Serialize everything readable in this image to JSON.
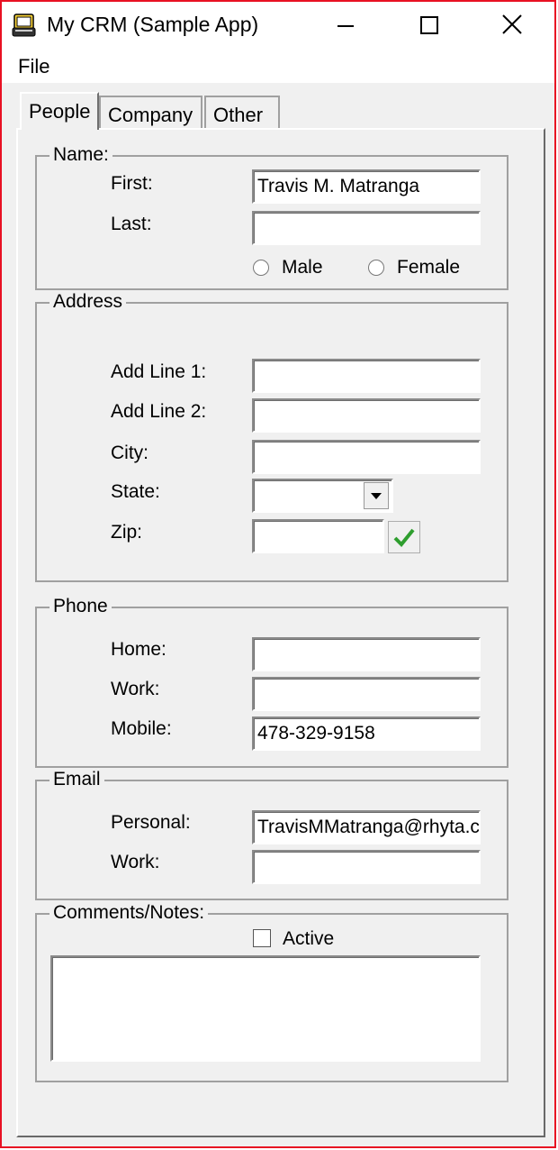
{
  "window": {
    "title": "My CRM (Sample App)"
  },
  "menu": {
    "file": "File"
  },
  "tabs": [
    {
      "label": "People"
    },
    {
      "label": "Company"
    },
    {
      "label": "Other"
    }
  ],
  "name_group": {
    "legend": "Name:",
    "first_label": "First:",
    "first_value": "Travis M. Matranga",
    "last_label": "Last:",
    "last_value": "",
    "male_label": "Male",
    "female_label": "Female"
  },
  "address_group": {
    "legend": "Address",
    "line1_label": "Add Line 1:",
    "line2_label": "Add Line 2:",
    "city_label": "City:",
    "state_label": "State:",
    "zip_label": "Zip:"
  },
  "phone_group": {
    "legend": "Phone",
    "home_label": "Home:",
    "work_label": "Work:",
    "mobile_label": "Mobile:",
    "mobile_value": "478-329-9158"
  },
  "email_group": {
    "legend": "Email",
    "personal_label": "Personal:",
    "personal_value": "TravisMMatranga@rhyta.com",
    "work_label": "Work:"
  },
  "comments_group": {
    "legend": "Comments/Notes:",
    "active_label": "Active"
  },
  "colors": {
    "window_border": "#e81123",
    "verify_check": "#2e9e2e"
  }
}
